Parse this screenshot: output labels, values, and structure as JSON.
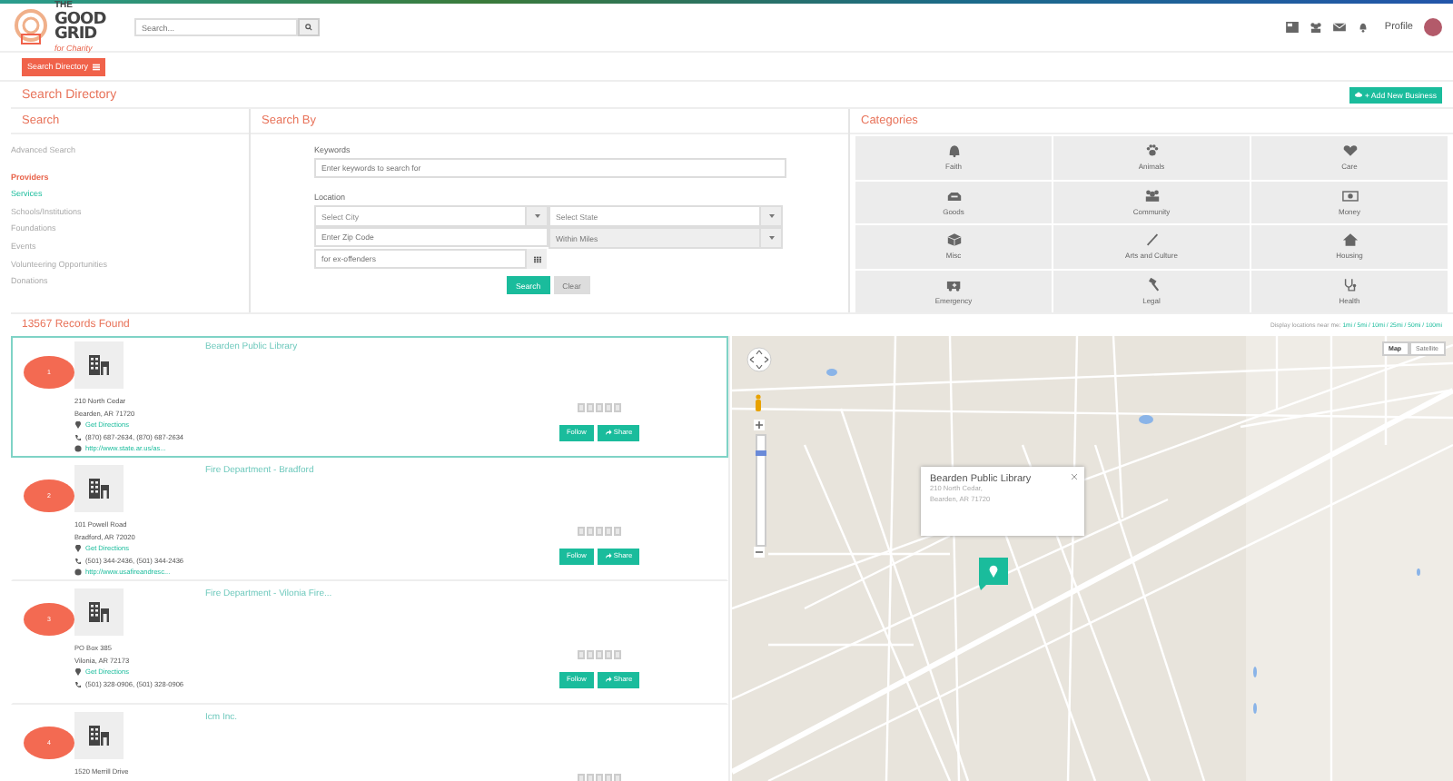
{
  "logo": {
    "small": "THE",
    "lines": [
      "GOOD",
      "GRID"
    ],
    "tagline": "for Charity"
  },
  "header": {
    "search": {
      "placeholder": "Search..."
    },
    "profile": "Profile"
  },
  "directory_button": "Search Directory",
  "page_title": "Search Directory",
  "add_business": "+ Add New Business",
  "search_panel": {
    "title": "Search",
    "advanced": "Advanced Search",
    "items": [
      {
        "label": "Providers",
        "selected": true,
        "highlighted": false
      },
      {
        "label": "Services",
        "selected": false,
        "highlighted": true
      },
      {
        "label": "Schools/Institutions",
        "selected": false,
        "highlighted": false
      },
      {
        "label": "Foundations",
        "selected": false,
        "highlighted": false
      },
      {
        "label": "Events",
        "selected": false,
        "highlighted": false
      },
      {
        "label": "Volunteering Opportunities",
        "selected": false,
        "highlighted": false
      },
      {
        "label": "Donations",
        "selected": false,
        "highlighted": false
      }
    ]
  },
  "search_by": {
    "title": "Search By",
    "keywords_label": "Keywords",
    "keywords": {
      "placeholder": "Enter keywords to search for"
    },
    "location_label": "Location",
    "city": {
      "placeholder": "Select City",
      "disabled": false
    },
    "state": {
      "placeholder": "Select State",
      "disabled": false
    },
    "zip": {
      "placeholder": "Enter Zip Code"
    },
    "miles": {
      "placeholder": "Within Miles",
      "disabled": true
    },
    "filter": {
      "placeholder": "for ex-offenders"
    },
    "buttons": [
      {
        "label": "Search",
        "kind": "primary"
      },
      {
        "label": "Clear",
        "kind": "secondary"
      }
    ]
  },
  "categories": {
    "title": "Categories",
    "items": [
      "Faith",
      "Animals",
      "Care",
      "Goods",
      "Community",
      "Money",
      "Misc",
      "Arts and Culture",
      "Housing",
      "Emergency",
      "Legal",
      "Health"
    ]
  },
  "results": {
    "count": "13567 Records Found",
    "near_me_label": "Display locations near me:",
    "distances": "1mi / 5mi / 10mi / 25mi / 50mi / 100mi",
    "items": [
      {
        "number": "1",
        "name": "Bearden Public Library",
        "address": [
          "210 North Cedar",
          "Bearden, AR 71720"
        ],
        "directions": "Get Directions",
        "phone": "(870) 687-2634, (870) 687-2634",
        "website": "http://www.state.ar.us/as...",
        "stars": 0,
        "actions": [
          "Follow",
          "Share"
        ],
        "selected": true
      },
      {
        "number": "2",
        "name": "Fire Department - Bradford",
        "address": [
          "101 Powell Road",
          "Bradford, AR 72020"
        ],
        "directions": "Get Directions",
        "phone": "(501) 344-2436, (501) 344-2436",
        "website": "http://www.usafireandresc...",
        "stars": 0,
        "actions": [
          "Follow",
          "Share"
        ],
        "selected": false
      },
      {
        "number": "3",
        "name": "Fire Department - Vilonia Fire...",
        "address": [
          "PO Box 385",
          "Vilonia, AR 72173"
        ],
        "directions": "Get Directions",
        "phone": "(501) 328-0906, (501) 328-0906",
        "stars": 0,
        "actions": [
          "Follow",
          "Share"
        ],
        "selected": false
      },
      {
        "number": "4",
        "name": "Icm Inc.",
        "address": [
          "1520 Merrill Drive"
        ],
        "stars": 0,
        "selected": false
      }
    ]
  },
  "map": {
    "zoom": {
      "level": 0.85
    },
    "types": [
      {
        "label": "Map",
        "selected": true
      },
      {
        "label": "Satellite",
        "selected": false
      }
    ],
    "popup": {
      "title": "Bearden Public Library",
      "lines": [
        "210 North Cedar,",
        "Bearden, AR 71720"
      ]
    }
  }
}
